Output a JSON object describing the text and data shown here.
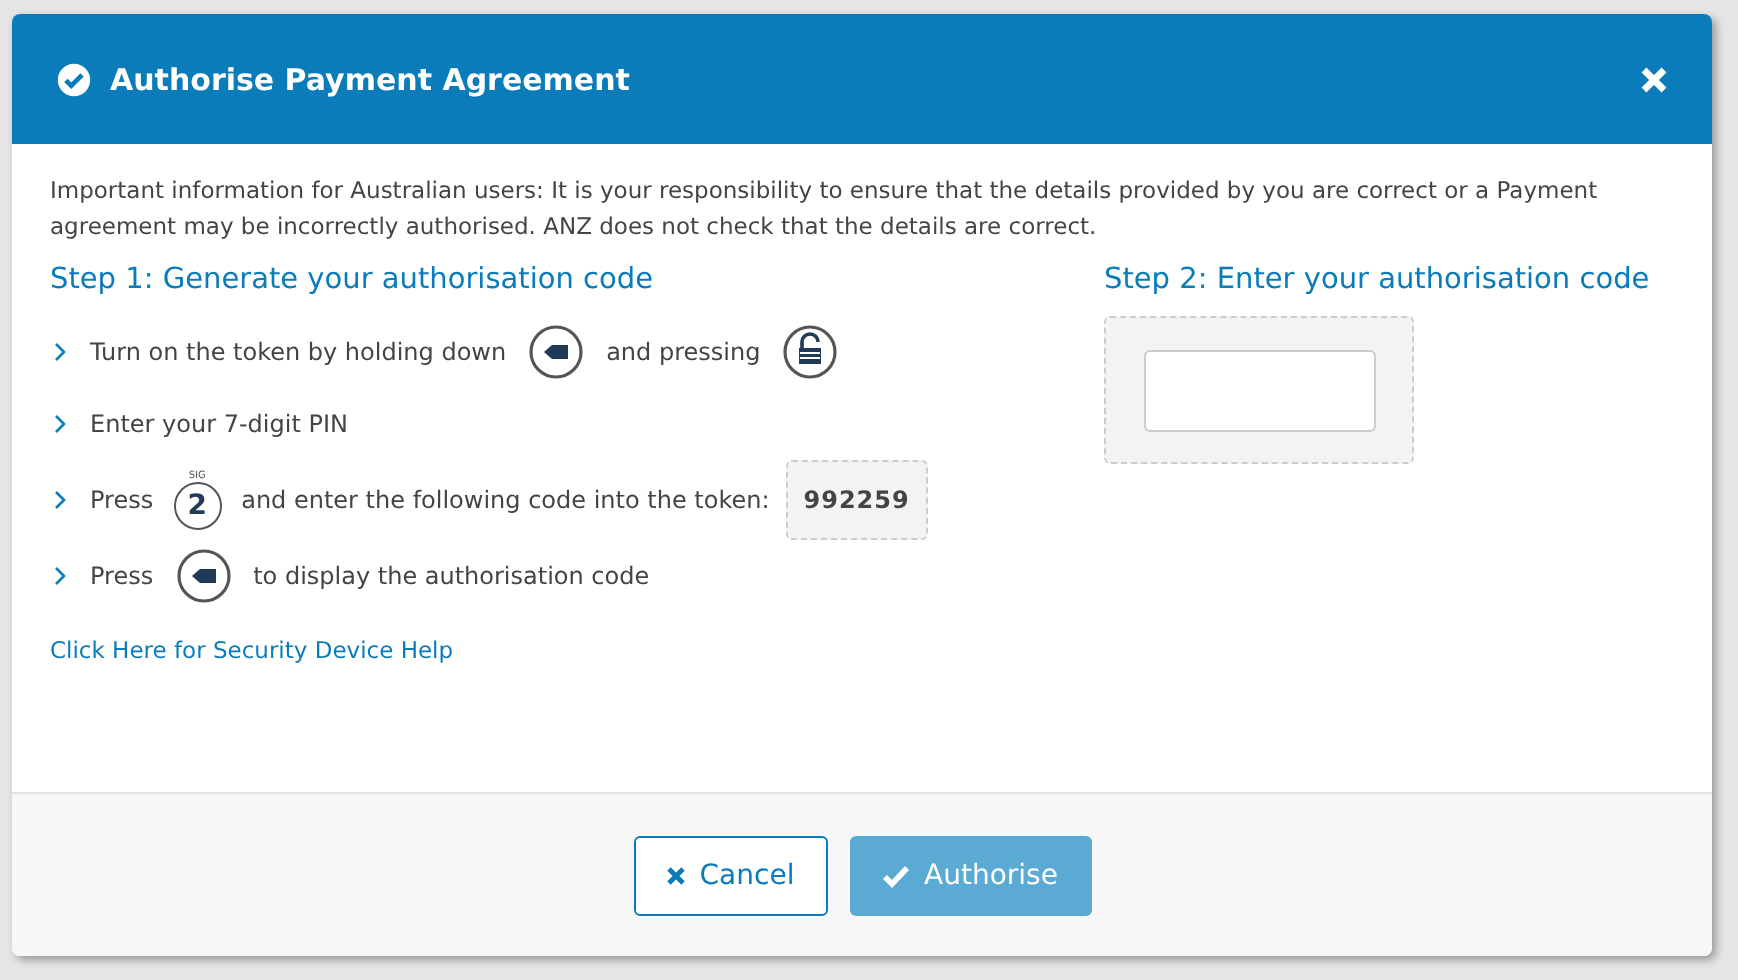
{
  "dialog": {
    "title": "Authorise Payment Agreement"
  },
  "notice": "Important information for Australian users: It is your responsibility to ensure that the details provided by you are correct or a Payment agreement may be incorrectly authorised. ANZ does not check that the details are correct.",
  "step1": {
    "heading": "Step 1: Generate your authorisation code",
    "steps": [
      {
        "parts": [
          {
            "kind": "text",
            "text": "Turn on the token by holding down"
          },
          {
            "kind": "back-key"
          },
          {
            "kind": "text",
            "text": "and pressing"
          },
          {
            "kind": "lock-key"
          }
        ]
      },
      {
        "parts": [
          {
            "kind": "text",
            "text": "Enter your 7-digit PIN"
          }
        ]
      },
      {
        "parts": [
          {
            "kind": "text",
            "text": "Press"
          },
          {
            "kind": "number-key",
            "text": "2",
            "caption": "SIG"
          },
          {
            "kind": "text",
            "text": "and enter the following code into the token:"
          },
          {
            "kind": "code",
            "text": "992259"
          }
        ]
      },
      {
        "parts": [
          {
            "kind": "text",
            "text": "Press"
          },
          {
            "kind": "back-key"
          },
          {
            "kind": "text",
            "text": "to display the authorisation code"
          }
        ]
      }
    ],
    "help_link": "Click Here for Security Device Help"
  },
  "step2": {
    "heading": "Step 2: Enter your authorisation code"
  },
  "buttons": [
    {
      "label": "Cancel",
      "kind": "cancel",
      "disabled": false
    },
    {
      "label": "Authorise",
      "kind": "confirm",
      "disabled": true
    }
  ]
}
